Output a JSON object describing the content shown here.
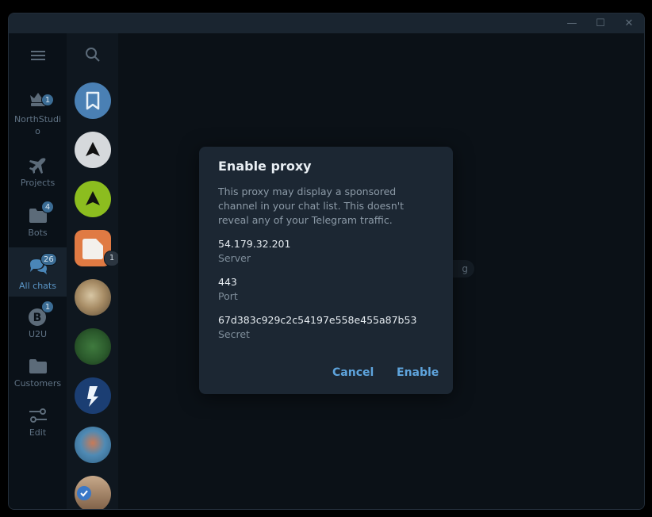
{
  "window": {
    "controls": {
      "minimize": "—",
      "maximize": "☐",
      "close": "✕"
    }
  },
  "folders": [
    {
      "label": "NorthStudio",
      "icon": "crown-icon",
      "badge": "1"
    },
    {
      "label": "Projects",
      "icon": "airplane-icon",
      "badge": ""
    },
    {
      "label": "Bots",
      "icon": "folder-icon",
      "badge": "4"
    },
    {
      "label": "All chats",
      "icon": "chat-bubbles-icon",
      "badge": "26",
      "active": true
    },
    {
      "label": "U2U",
      "icon": "bitcoin-icon",
      "badge": "1"
    },
    {
      "label": "Customers",
      "icon": "folder-icon",
      "badge": ""
    },
    {
      "label": "Edit",
      "icon": "sliders-icon",
      "badge": ""
    }
  ],
  "chat_list": {
    "avatars": [
      {
        "name": "saved-messages-avatar",
        "badge": ""
      },
      {
        "name": "chat-avatar-2",
        "badge": ""
      },
      {
        "name": "chat-avatar-3",
        "badge": ""
      },
      {
        "name": "chat-avatar-4",
        "badge": "1"
      },
      {
        "name": "chat-avatar-5",
        "badge": ""
      },
      {
        "name": "chat-avatar-6",
        "badge": ""
      },
      {
        "name": "chat-avatar-7",
        "badge": ""
      },
      {
        "name": "chat-avatar-8",
        "badge": ""
      },
      {
        "name": "chat-avatar-9",
        "badge": ""
      }
    ]
  },
  "main": {
    "hint_text": "g"
  },
  "dialog": {
    "title": "Enable proxy",
    "description": "This proxy may display a sponsored channel in your chat list. This doesn't reveal any of your Telegram traffic.",
    "server_value": "54.179.32.201",
    "server_label": "Server",
    "port_value": "443",
    "port_label": "Port",
    "secret_value": "67d383c929c2c54197e558e455a87b53",
    "secret_label": "Secret",
    "cancel_label": "Cancel",
    "enable_label": "Enable"
  },
  "colors": {
    "accent": "#5ea4dd",
    "badge": "#3b6c94",
    "dialog_bg": "#1c2733"
  }
}
